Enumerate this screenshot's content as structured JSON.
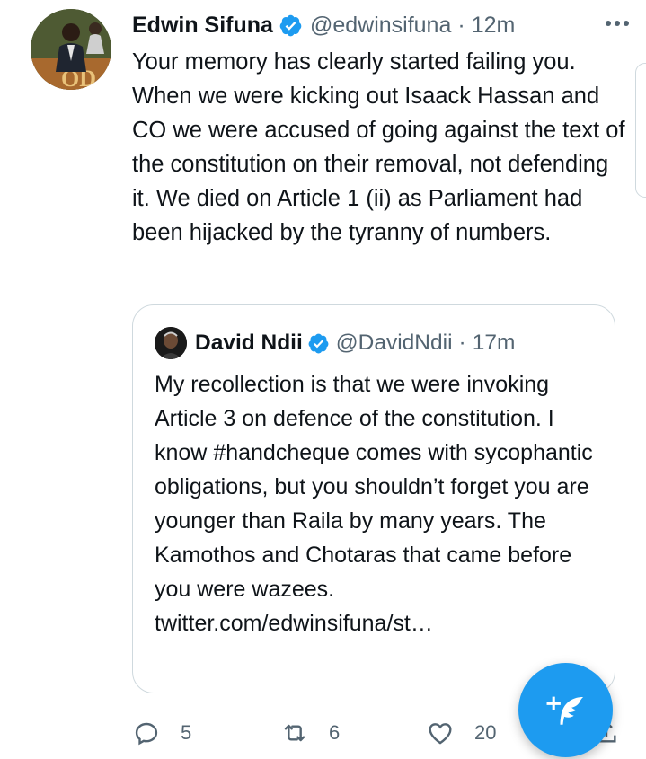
{
  "tweet": {
    "author_name": "Edwin Sifuna",
    "author_handle": "@edwinsifuna",
    "separator": "·",
    "time": "12m",
    "text": "Your memory has clearly started failing you. When we were kicking out Isaack Hassan and CO we were accused of going against the text of the constitution on their removal, not defending it. We died on Article 1 (ii) as Parliament had been hijacked by the tyranny of numbers."
  },
  "quoted_tweet": {
    "author_name": "David Ndii",
    "author_handle": "@DavidNdii",
    "separator": "·",
    "time": "17m",
    "text": "My recollection is that we were invoking Article 3 on defence of the constitution. I know #handcheque comes with sycophantic obligations, but you shouldn’t forget you are younger than Raila by many years. The Kamothos and Chotaras that came before you were wazees. twitter.com/edwinsifuna/st…"
  },
  "actions": {
    "reply_count": "5",
    "retweet_count": "6",
    "like_count": "20"
  },
  "icons": {
    "verified": "verified-badge-icon",
    "more": "more-dots-icon",
    "reply": "reply-icon",
    "retweet": "retweet-icon",
    "like": "heart-icon",
    "share": "share-icon",
    "compose": "compose-tweet-icon"
  },
  "colors": {
    "accent": "#1d9bf0",
    "secondary_text": "#536471",
    "primary_text": "#0f1419",
    "border": "#cfd9de"
  }
}
